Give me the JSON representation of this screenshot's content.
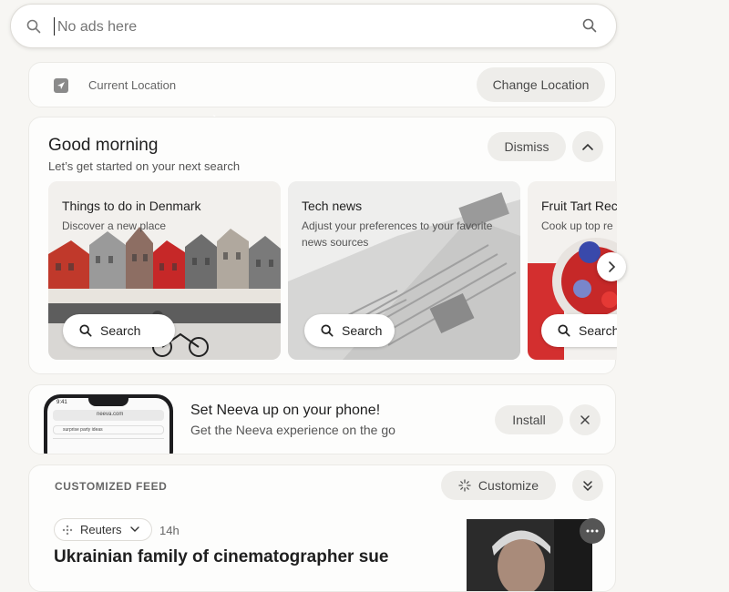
{
  "search": {
    "placeholder": "No ads here"
  },
  "location": {
    "label": "Current Location",
    "change_button": "Change Location"
  },
  "greeting": {
    "title": "Good morning",
    "subtitle": "Let’s get started on your next search",
    "dismiss_button": "Dismiss"
  },
  "suggestions": [
    {
      "title": "Things to do in Denmark",
      "subtitle": "Discover a new place",
      "button": "Search"
    },
    {
      "title": "Tech news",
      "subtitle": "Adjust your preferences to your favorite news sources",
      "button": "Search"
    },
    {
      "title": "Fruit Tart Reci",
      "subtitle": "Cook up top re",
      "button": "Search"
    }
  ],
  "phone_promo": {
    "title": "Set Neeva up on your phone!",
    "subtitle": "Get the Neeva experience on the go",
    "install_button": "Install",
    "phone_time": "9:41",
    "phone_url": "neeva.com",
    "phone_search_text": "surprise party ideas"
  },
  "feed": {
    "header": "CUSTOMIZED FEED",
    "customize_button": "Customize",
    "article": {
      "source": "Reuters",
      "age": "14h",
      "headline": "Ukrainian family of cinematographer sue"
    }
  },
  "colors": {
    "background": "#f7f6f3",
    "card": "#fdfdfc",
    "pill": "#eeedea"
  }
}
